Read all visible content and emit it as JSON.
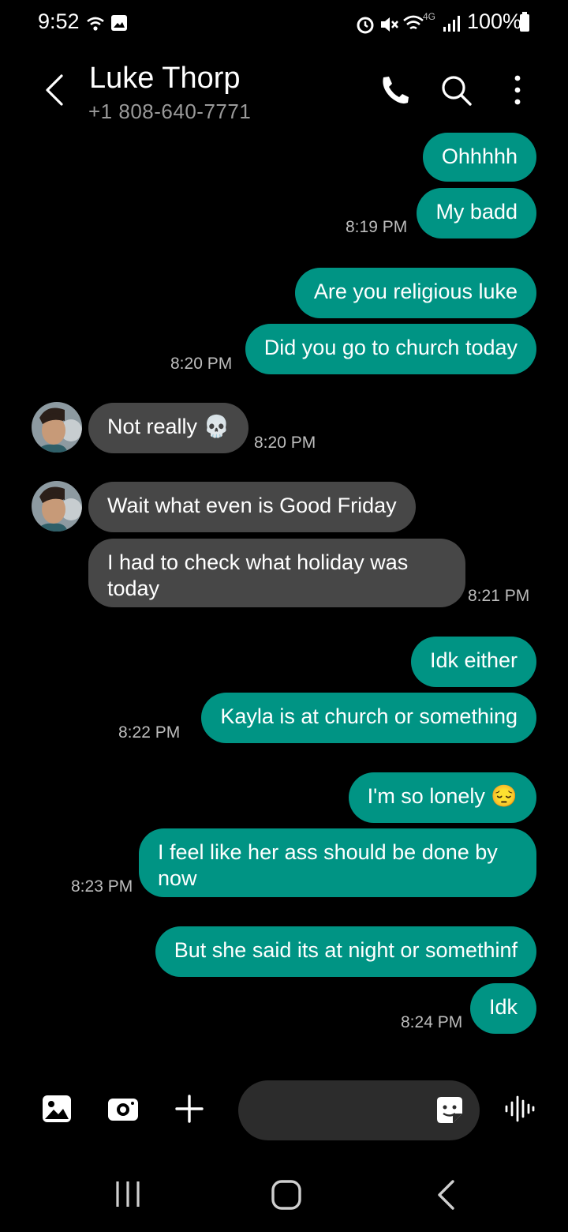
{
  "status_bar": {
    "time": "9:52",
    "battery_text": "100%",
    "network": "4G"
  },
  "header": {
    "contact_name": "Luke Thorp",
    "contact_number": "+1 808-640-7771"
  },
  "messages": {
    "m1": "Ohhhhh",
    "m2": "My badd",
    "t1": "8:19 PM",
    "m3": "Are you religious luke",
    "m4": "Did you go to church today",
    "t2": "8:20 PM",
    "m5": "Not really 💀",
    "t3": "8:20 PM",
    "m6": "Wait what even is Good Friday",
    "m7a": "I had to check what holiday was",
    "m7b": "today",
    "t4": "8:21 PM",
    "m8": "Idk either",
    "m9": "Kayla is at church or something",
    "t5": "8:22 PM",
    "m10": "I'm so lonely 😔",
    "m11a": "I feel like her ass should be done by",
    "m11b": "now",
    "t6": "8:23 PM",
    "m12": "But she said its at night or somethinf",
    "m13": "Idk",
    "t7": "8:24 PM"
  },
  "composer": {
    "placeholder": ""
  },
  "icons": {
    "back": "chevron-left-icon",
    "call": "phone-icon",
    "search": "search-icon",
    "more": "more-vertical-icon",
    "gallery": "gallery-icon",
    "camera": "camera-icon",
    "add": "plus-icon",
    "sticker": "sticker-icon",
    "voice": "voice-wave-icon"
  },
  "colors": {
    "outgoing_bubble": "#009484",
    "incoming_bubble": "#474747",
    "background": "#000000"
  }
}
